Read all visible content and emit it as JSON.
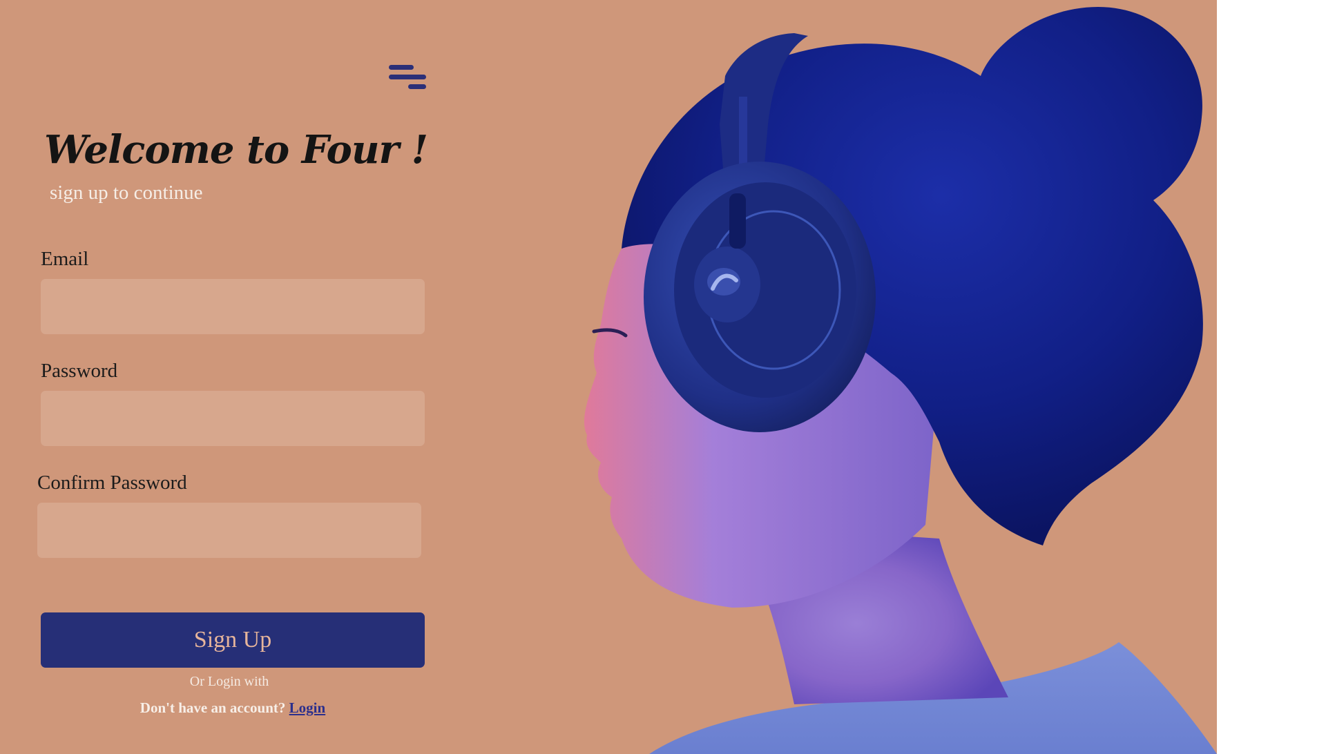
{
  "header": {
    "menu_icon": "hamburger-menu-icon"
  },
  "hero": {
    "title": "Welcome to Four !",
    "subtitle": "sign up to continue"
  },
  "form": {
    "email_label": "Email",
    "email_value": "",
    "password_label": "Password",
    "password_value": "",
    "confirm_label": "Confirm Password",
    "confirm_value": "",
    "submit_label": "Sign Up"
  },
  "footer": {
    "or_login_text": "Or Login with",
    "no_account_text": "Don't have an account?",
    "login_link": "Login"
  },
  "image": {
    "description": "person-with-headphones-photo"
  },
  "colors": {
    "background": "#cf977a",
    "input_fill": "#d7a78d",
    "button": "#262f77",
    "button_text": "#e7b59b",
    "accent": "#2b2f78"
  }
}
